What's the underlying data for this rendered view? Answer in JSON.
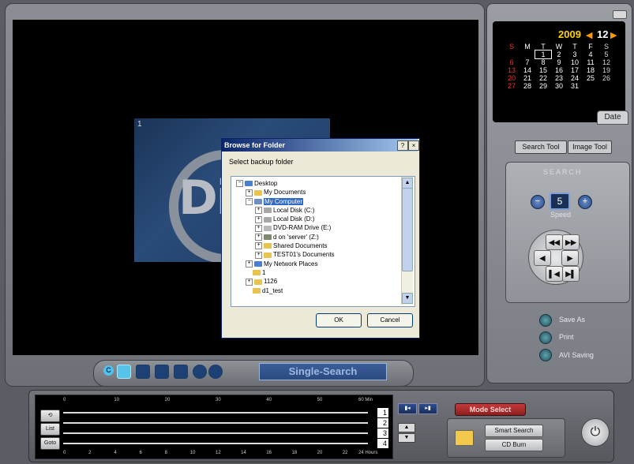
{
  "calendar": {
    "year": "2009",
    "month": "12",
    "prev_arrow": "◀",
    "next_arrow": "▶",
    "weekdays": [
      "S",
      "M",
      "T",
      "W",
      "T",
      "F",
      "S"
    ],
    "weeks": [
      [
        "",
        "",
        "1",
        "2",
        "3",
        "4",
        "5"
      ],
      [
        "6",
        "7",
        "8",
        "9",
        "10",
        "11",
        "12"
      ],
      [
        "13",
        "14",
        "15",
        "16",
        "17",
        "18",
        "19"
      ],
      [
        "20",
        "21",
        "22",
        "23",
        "24",
        "25",
        "26"
      ],
      [
        "27",
        "28",
        "29",
        "30",
        "31",
        "",
        ""
      ]
    ],
    "selected_day": "1",
    "tab_label": "Date"
  },
  "tools": {
    "search_tool": "Search Tool",
    "image_tool": "Image Tool"
  },
  "search": {
    "label": "SEARCH",
    "speed_value": "5",
    "speed_label": "Speed",
    "minus": "−",
    "plus": "+",
    "dpad": {
      "fast_rewind": "◀◀",
      "fast_forward": "▶▶",
      "step_back": "◀",
      "step_forward": "▶",
      "first": "▌◀",
      "last": "▶▌"
    }
  },
  "actions": {
    "save_as": "Save As",
    "print": "Print",
    "avi_saving": "AVI Saving"
  },
  "view_mode": {
    "mode_label": "Single-Search",
    "letter": "C"
  },
  "thumbnail": {
    "index": "1",
    "logo_text": "Di"
  },
  "dialog": {
    "title": "Browse for Folder",
    "help": "?",
    "close": "×",
    "message": "Select backup folder",
    "tree": [
      {
        "label": "Desktop",
        "indent": 0,
        "expander": "−",
        "icon": "desktop",
        "color": "#4a7fd0"
      },
      {
        "label": "My Documents",
        "indent": 1,
        "expander": "+",
        "icon": "folder",
        "color": "#e9c34f"
      },
      {
        "label": "My Computer",
        "indent": 1,
        "expander": "−",
        "icon": "computer",
        "color": "#6d8fc4",
        "selected": true
      },
      {
        "label": "Local Disk (C:)",
        "indent": 2,
        "expander": "+",
        "icon": "drive",
        "color": "#a7a7a7"
      },
      {
        "label": "Local Disk (D:)",
        "indent": 2,
        "expander": "+",
        "icon": "drive",
        "color": "#a7a7a7"
      },
      {
        "label": "DVD-RAM Drive (E:)",
        "indent": 2,
        "expander": "+",
        "icon": "dvd",
        "color": "#b8b8b8"
      },
      {
        "label": "d on 'server' (Z:)",
        "indent": 2,
        "expander": "+",
        "icon": "network-drive",
        "color": "#7d8b6c"
      },
      {
        "label": "Shared Documents",
        "indent": 2,
        "expander": "+",
        "icon": "folder",
        "color": "#e9c34f"
      },
      {
        "label": "TEST01's Documents",
        "indent": 2,
        "expander": "+",
        "icon": "folder",
        "color": "#e9c34f"
      },
      {
        "label": "My Network Places",
        "indent": 1,
        "expander": "+",
        "icon": "network",
        "color": "#4a7fd0"
      },
      {
        "label": "1",
        "indent": 1,
        "expander": "",
        "icon": "folder",
        "color": "#e9c34f"
      },
      {
        "label": "1126",
        "indent": 1,
        "expander": "+",
        "icon": "folder",
        "color": "#e9c34f"
      },
      {
        "label": "d1_test",
        "indent": 1,
        "expander": "",
        "icon": "folder",
        "color": "#e9c34f"
      }
    ],
    "ok": "OK",
    "cancel": "Cancel"
  },
  "timeline": {
    "minute_ticks": [
      "0",
      "10",
      "20",
      "30",
      "40",
      "50",
      "60 Min"
    ],
    "hour_ticks": [
      "0",
      "2",
      "4",
      "6",
      "8",
      "10",
      "12",
      "14",
      "16",
      "18",
      "20",
      "22",
      "24 Hours"
    ],
    "channels": [
      "1",
      "2",
      "3",
      "4"
    ],
    "side_buttons": [
      "⟲",
      "List",
      "Goto"
    ]
  },
  "controls": {
    "mode_select": "Mode Select",
    "smart_search": "Smart Search",
    "cd_burn": "CD Burn",
    "power": "⏻",
    "up": "▲",
    "down": "▼"
  }
}
